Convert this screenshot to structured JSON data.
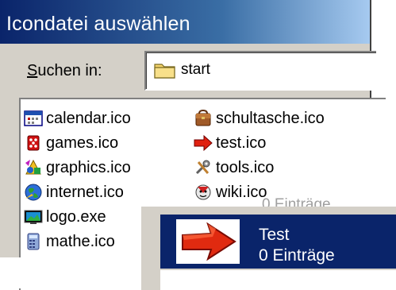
{
  "dialog": {
    "title": "Icondatei auswählen",
    "look_in": {
      "label_underlined": "S",
      "label_rest": "uchen in:",
      "value": "start",
      "icon": "folder-icon"
    }
  },
  "files": [
    {
      "name": "calendar.ico",
      "icon": "calendar-icon"
    },
    {
      "name": "games.ico",
      "icon": "games-icon"
    },
    {
      "name": "graphics.ico",
      "icon": "graphics-icon"
    },
    {
      "name": "internet.ico",
      "icon": "internet-icon"
    },
    {
      "name": "logo.exe",
      "icon": "logo-icon"
    },
    {
      "name": "mathe.ico",
      "icon": "mathe-icon"
    },
    {
      "name": "schultasche.ico",
      "icon": "schoolbag-icon"
    },
    {
      "name": "test.ico",
      "icon": "arrow-icon"
    },
    {
      "name": "tools.ico",
      "icon": "tools-icon"
    },
    {
      "name": "wiki.ico",
      "icon": "wiki-icon"
    }
  ],
  "popup": {
    "ghost_text": "0 Einträge",
    "selected_item": {
      "title": "Test",
      "subtitle": "0 Einträge",
      "icon": "red-arrow-icon"
    }
  },
  "colors": {
    "titlebar_start": "#0a246a",
    "titlebar_end": "#a6caf0",
    "selection": "#0a246a",
    "window_face": "#d4d0c8"
  }
}
